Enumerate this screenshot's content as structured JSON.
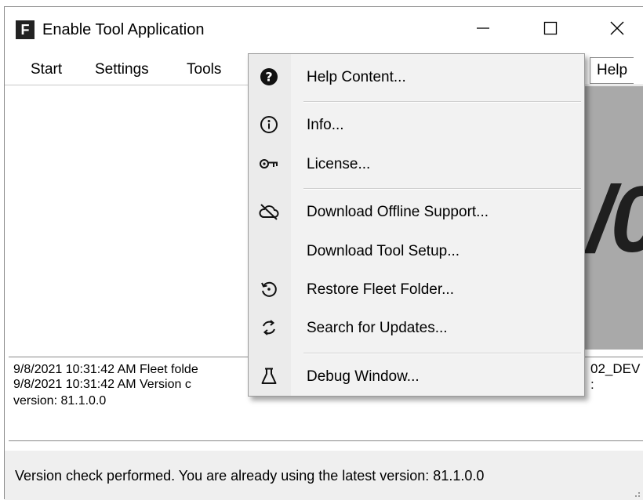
{
  "window": {
    "app_icon_letter": "F",
    "title": "Enable Tool Application",
    "minimize_glyph": "—",
    "close_glyph": "✕"
  },
  "menubar": {
    "items": [
      "Start",
      "Settings",
      "Tools",
      "Help"
    ]
  },
  "help_menu": {
    "items": [
      {
        "label": "Help Content...",
        "icon": "question-circle-icon"
      },
      {
        "label": "Info...",
        "icon": "info-circle-icon"
      },
      {
        "label": "License...",
        "icon": "key-icon"
      },
      {
        "label": "Download Offline Support...",
        "icon": "cloud-offline-icon"
      },
      {
        "label": "Download Tool Setup...",
        "icon": ""
      },
      {
        "label": "Restore Fleet Folder...",
        "icon": "restore-icon"
      },
      {
        "label": "Search for Updates...",
        "icon": "sync-icon"
      },
      {
        "label": "Debug Window...",
        "icon": "flask-icon"
      }
    ]
  },
  "log": {
    "lines": [
      "9/8/2021 10:31:42 AM Fleet folde",
      "9/8/2021 10:31:42 AM Version c",
      "version: 81.1.0.0"
    ],
    "right_fragment": "02_DEV",
    "right_fragment2": ":"
  },
  "status": {
    "text": "Version check performed. You are already using the latest version: 81.1.0.0"
  },
  "colors": {
    "menu_bg": "#f2f2f2",
    "logo_bg": "#a9a9a9",
    "status_bg": "#efefef"
  }
}
